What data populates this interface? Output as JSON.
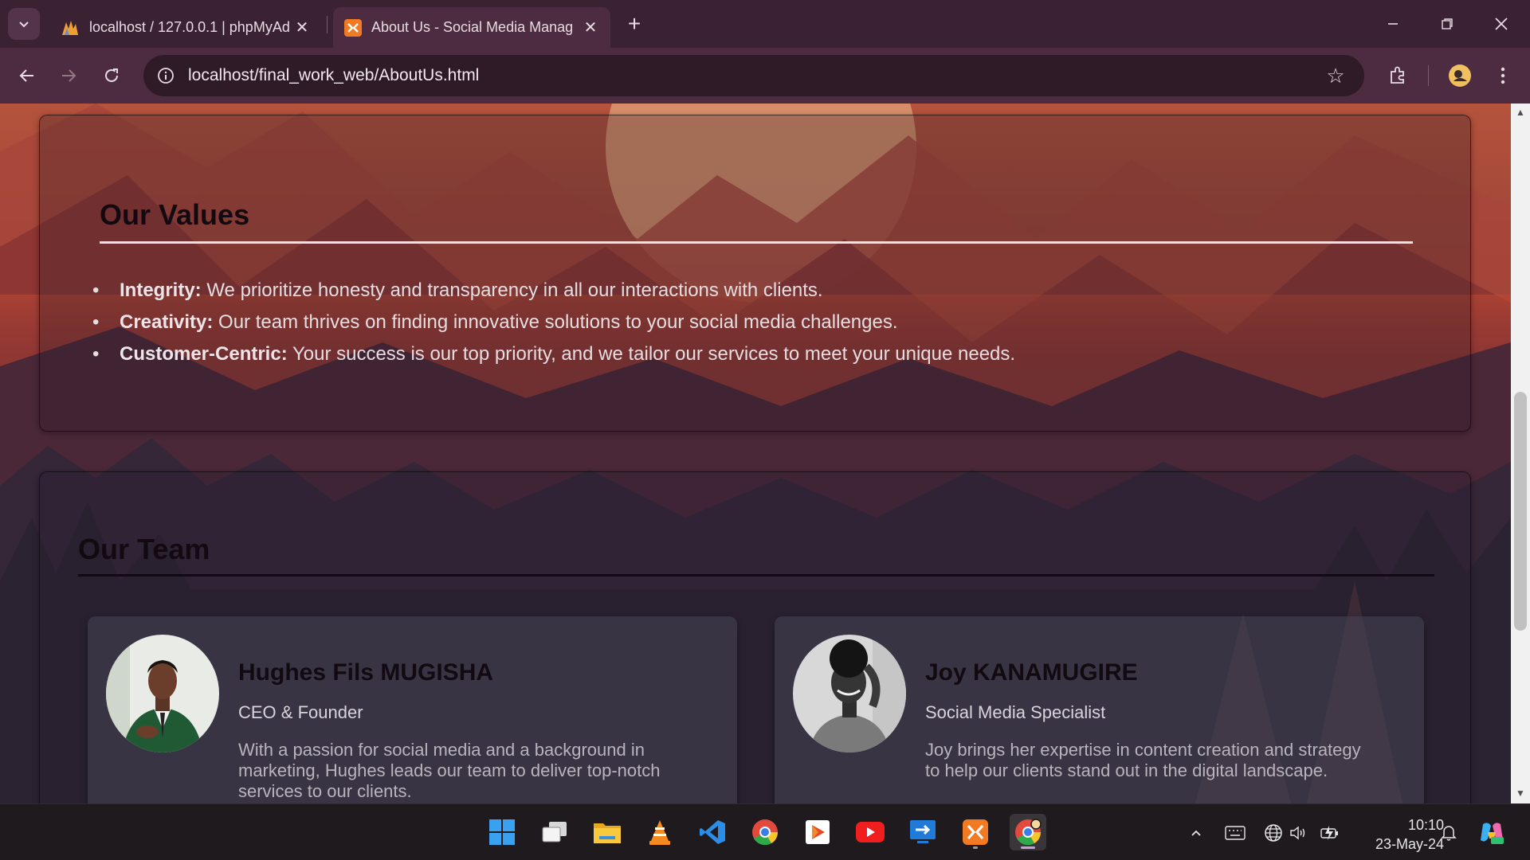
{
  "browser": {
    "tabs": [
      {
        "title": "localhost / 127.0.0.1 | phpMyAd",
        "icon": "phpmyadmin-icon",
        "active": false
      },
      {
        "title": "About Us - Social Media Manag",
        "icon": "xampp-icon",
        "active": true
      }
    ],
    "url": "localhost/final_work_web/AboutUs.html"
  },
  "values": {
    "title": "Our Values",
    "items": [
      {
        "label": "Integrity:",
        "text": " We prioritize honesty and transparency in all our interactions with clients."
      },
      {
        "label": "Creativity:",
        "text": " Our team thrives on finding innovative solutions to your social media challenges."
      },
      {
        "label": "Customer-Centric:",
        "text": " Your success is our top priority, and we tailor our services to meet your unique needs."
      }
    ]
  },
  "team": {
    "title": "Our Team",
    "members": [
      {
        "name": "Hughes Fils MUGISHA",
        "role": "CEO & Founder",
        "bio": "With a passion for social media and a background in marketing, Hughes leads our team to deliver top-notch services to our clients."
      },
      {
        "name": "Joy KANAMUGIRE",
        "role": "Social Media Specialist",
        "bio": "Joy brings her expertise in content creation and strategy to help our clients stand out in the digital landscape."
      }
    ]
  },
  "taskbar": {
    "apps": [
      "windows-start-icon",
      "task-view-icon",
      "file-explorer-icon",
      "vlc-icon",
      "vscode-icon",
      "chrome-icon",
      "media-player-icon",
      "youtube-icon",
      "remote-desktop-icon",
      "xampp-icon",
      "chrome-profile-icon"
    ],
    "time": "10:10",
    "date": "23-May-24"
  },
  "colors": {
    "chrome_frame": "#3a2232",
    "chrome_toolbar": "#4d2c41",
    "heading_text": "#120a10",
    "body_text": "#e6dde0"
  }
}
